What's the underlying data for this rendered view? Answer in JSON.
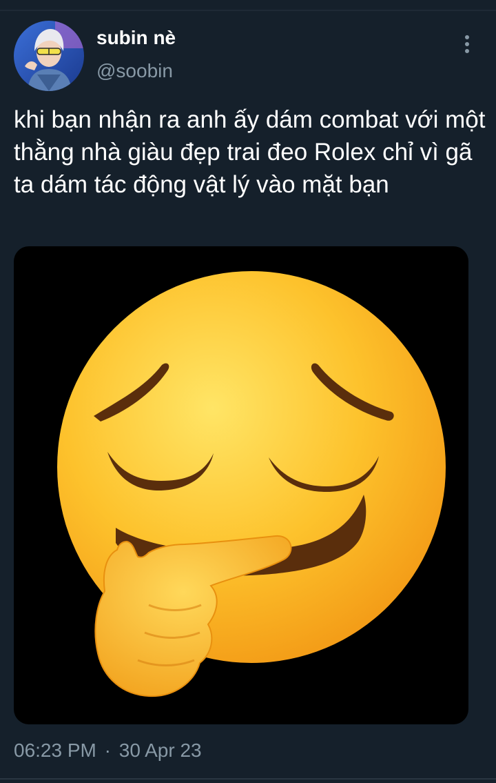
{
  "tweet": {
    "display_name": "subin nè",
    "handle": "@soobin",
    "text": "khi bạn nhận ra anh ấy dám combat với một thằng nhà giàu đẹp trai đeo Rolex chỉ vì gã ta dám tác động vật lý vào mặt bạn",
    "time": "06:23 PM",
    "separator": "·",
    "date": "30 Apr 23"
  },
  "media": {
    "emoji_icon": "thinking-relieved-face-emoji"
  },
  "colors": {
    "background": "#15202b",
    "text_primary": "#ffffff",
    "text_secondary": "#8899a6"
  }
}
